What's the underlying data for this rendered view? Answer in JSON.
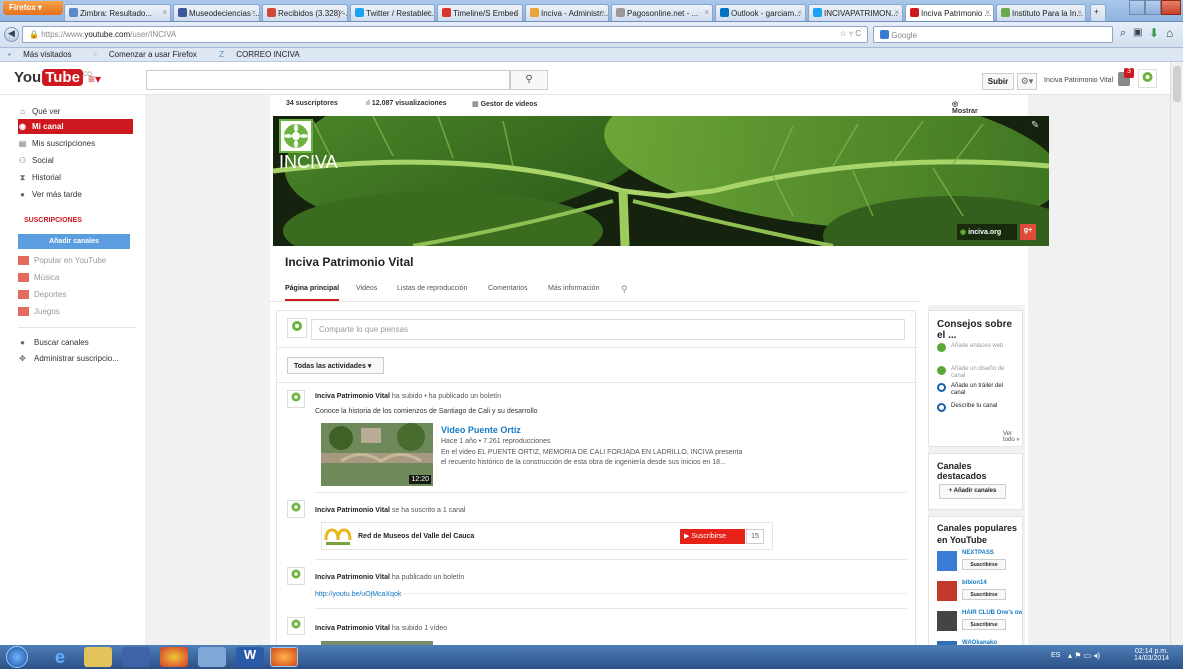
{
  "browser": {
    "app_button": "Firefox",
    "tabs": [
      {
        "label": "Zimbra: Resultado...",
        "color": "#5a8ac6"
      },
      {
        "label": "Museodeciencias ...",
        "color": "#3b5998"
      },
      {
        "label": "Recibidos (3.328) -...",
        "color": "#d44638"
      },
      {
        "label": "Twitter / Restablec...",
        "color": "#1da1f2"
      },
      {
        "label": "Timeline/S Embed",
        "color": "#d9342b"
      },
      {
        "label": "Inciva - Administr...",
        "color": "#e8a33a"
      },
      {
        "label": "Pagosonline.net - ...",
        "color": "#999999"
      },
      {
        "label": "Outlook - garciam...",
        "color": "#0072c6"
      },
      {
        "label": "INCIVAPATRIMON...",
        "color": "#1da1f2"
      },
      {
        "label": "Inciva Patrimonio ...",
        "color": "#cc181e"
      },
      {
        "label": "Instituto Para la In...",
        "color": "#6aa84f"
      }
    ],
    "url_prefix": "https://www.",
    "url_domain": "youtube.com",
    "url_path": "/user/INCIVA",
    "search_placeholder": "Google",
    "bookmarks": [
      "Más visitados",
      "Comenzar a usar Firefox",
      "CORREO INCIVA"
    ]
  },
  "youtube": {
    "logo_you": "You",
    "logo_tube": "Tube",
    "logo_co": "CO",
    "search_icon": "search-icon",
    "subir": "Subir",
    "user_name": "Inciva Patrimonio Vital",
    "notification_count": "3"
  },
  "sidebar": {
    "items": [
      {
        "label": "Qué ver",
        "icon": "home-icon",
        "glyph": "⌂"
      },
      {
        "label": "Mi canal",
        "icon": "channel-icon",
        "glyph": "◉"
      },
      {
        "label": "Mis suscripciones",
        "icon": "subscriptions-icon",
        "glyph": "▤"
      },
      {
        "label": "Social",
        "icon": "social-icon",
        "glyph": "⚇"
      },
      {
        "label": "Historial",
        "icon": "history-icon",
        "glyph": "⧗"
      },
      {
        "label": "Ver más tarde",
        "icon": "clock-icon",
        "glyph": "●"
      }
    ],
    "subs_heading": "SUSCRIPCIONES",
    "add_channels": "Añadir canales",
    "subs": [
      "Popular en YouTube",
      "Música",
      "Deportes",
      "Juegos"
    ],
    "bottom": [
      "Buscar canales",
      "Administrar suscripcio..."
    ]
  },
  "channel": {
    "subscribers": "34 suscriptores",
    "views": "12.087 visualizaciones",
    "video_manager": "Gestor de videos",
    "show_public": "Mostrar como público",
    "banner_name": "INCIVA",
    "banner_link": "inciva.org",
    "title": "Inciva Patrimonio Vital",
    "tabs": [
      "Página principal",
      "Videos",
      "Listas de reproducción",
      "Comentarios",
      "Más información"
    ],
    "share_placeholder": "Comparte lo que piensas",
    "filter": "Todas las actividades",
    "feed": {
      "item1_user": "Inciva Patrimonio Vital",
      "item1_action": "ha subido • ha publicado un boletín",
      "item1_text": "Conoce la historia de los comienzos de Santiago de Cali y su desarrollo",
      "video_title": "Video Puente Ortiz",
      "video_meta": "Hace 1 año • 7.261 reproducciones",
      "video_desc1": "En el video EL PUENTE ORTIZ, MEMORIA DE CALI FORJADA EN LADRILLO, INCIVA presenta",
      "video_desc2": "el recuento histórico de la construcción de esta obra de ingeniería desde sus inicios en 18...",
      "video_duration": "12:20",
      "item2_user": "Inciva Patrimonio Vital",
      "item2_action": "se ha suscrito a 1 canal",
      "item2_channel": "Red de Museos del Valle del Cauca",
      "item2_subscribe": "Suscribirse",
      "item2_count": "15",
      "item3_user": "Inciva Patrimonio Vital",
      "item3_action": "ha publicado un boletín",
      "item3_link": "http://youtu.be/uOjMcaXqok",
      "item4_user": "Inciva Patrimonio Vital",
      "item4_action": "ha subido 1 vídeo"
    }
  },
  "right": {
    "tips_title": "Consejos sobre el ...",
    "tips": [
      {
        "label": "Añade enlaces web",
        "done": true
      },
      {
        "label": "Añade un diseño de canal",
        "done": true
      },
      {
        "label": "Añade un tráiler del canal",
        "done": false
      },
      {
        "label": "Describe tu canal",
        "done": false
      }
    ],
    "see_all": "Ver todo »",
    "featured_title": "Canales destacados",
    "add_channels": "+ Añadir canales",
    "popular_title": "Canales populares en YouTube",
    "popular": [
      {
        "name": "NEXTPASS",
        "btn": "Suscribirse",
        "color": "#3a7bd5"
      },
      {
        "name": "bibion14",
        "btn": "Suscribirse",
        "color": "#c0392b"
      },
      {
        "name": "HAIR CLUB One's own",
        "btn": "Suscribirse",
        "color": "#444444"
      },
      {
        "name": "WAOkanako",
        "btn": "",
        "color": "#2c6fbb"
      }
    ]
  },
  "taskbar": {
    "lang": "ES",
    "time": "02:14 p.m.",
    "date": "14/03/2014"
  }
}
